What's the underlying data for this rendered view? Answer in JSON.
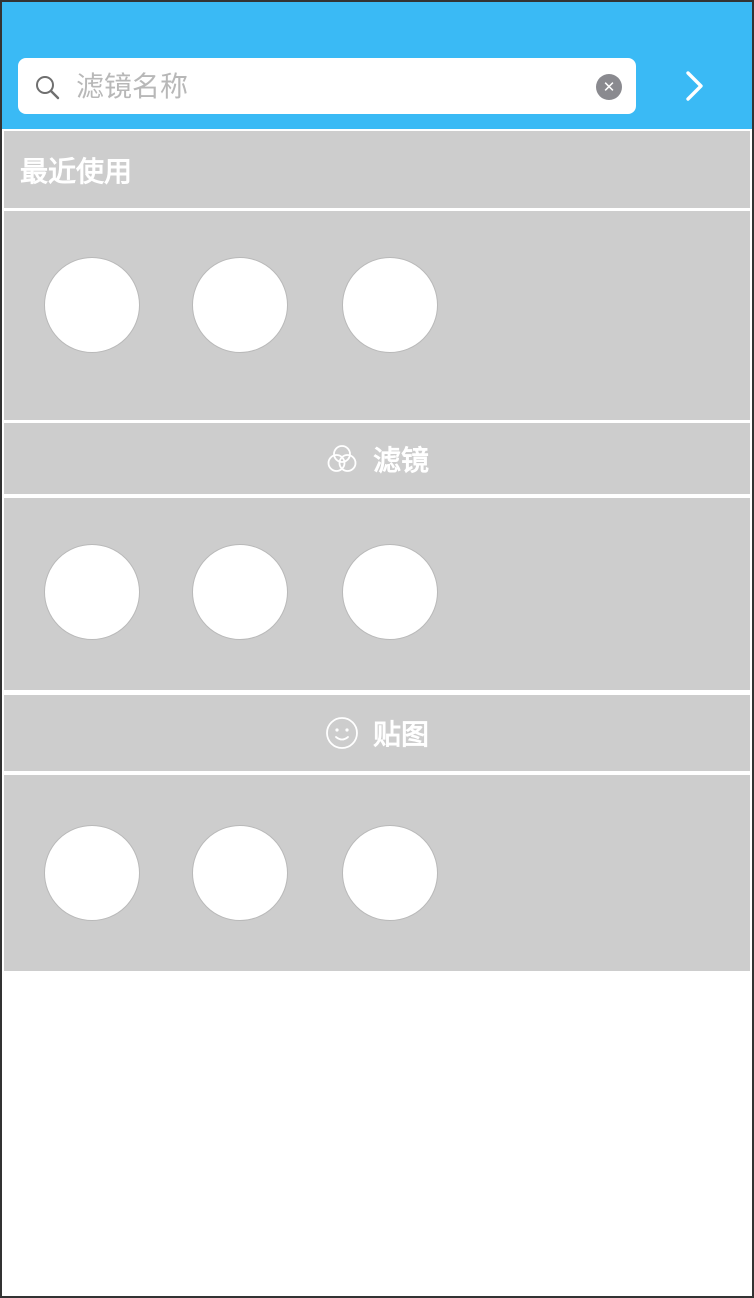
{
  "colors": {
    "accent": "#3ABAF5",
    "panel": "#CDCDCD",
    "item": "#FFFFFF"
  },
  "search": {
    "placeholder": "滤镜名称",
    "value": "",
    "search_icon": "search-icon",
    "clear_icon": "clear-icon"
  },
  "next_button": {
    "icon": "chevron-right-icon"
  },
  "sections": [
    {
      "title": "最近使用",
      "icon": null,
      "items": [
        1,
        2,
        3
      ]
    },
    {
      "title": "滤镜",
      "icon": "filter-circles-icon",
      "items": [
        1,
        2,
        3
      ]
    },
    {
      "title": "贴图",
      "icon": "smiley-icon",
      "items": [
        1,
        2,
        3
      ]
    }
  ]
}
